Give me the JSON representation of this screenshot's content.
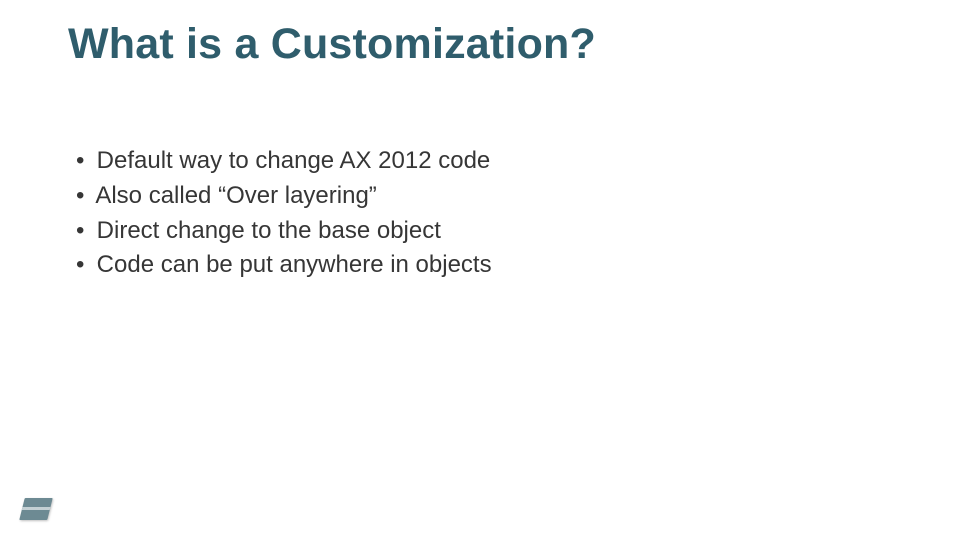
{
  "slide": {
    "title": "What is a Customization?",
    "bullets": [
      "Default way to change AX 2012 code",
      "Also called “Over layering”",
      "Direct change to the base object",
      "Code can be put anywhere in objects"
    ]
  }
}
